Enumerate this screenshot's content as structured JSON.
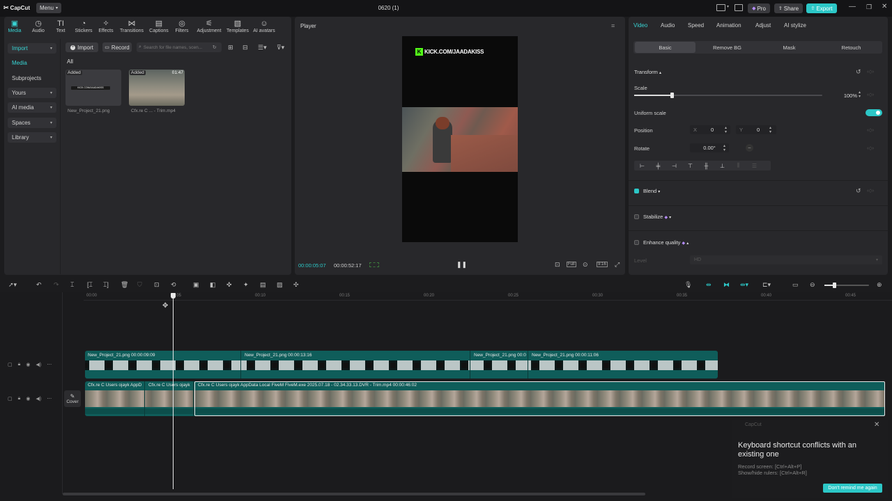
{
  "app": {
    "logo": "CapCut",
    "menu_label": "Menu",
    "project_title": "0620 (1)",
    "pro_label": "Pro",
    "share_label": "Share",
    "export_label": "Export",
    "accent": "#2cc7c7"
  },
  "toolbar": {
    "items": [
      {
        "label": "Media",
        "icon": "media-icon"
      },
      {
        "label": "Audio",
        "icon": "audio-icon"
      },
      {
        "label": "Text",
        "icon": "text-icon"
      },
      {
        "label": "Stickers",
        "icon": "stickers-icon"
      },
      {
        "label": "Effects",
        "icon": "effects-icon"
      },
      {
        "label": "Transitions",
        "icon": "transitions-icon"
      },
      {
        "label": "Captions",
        "icon": "captions-icon"
      },
      {
        "label": "Filters",
        "icon": "filters-icon"
      },
      {
        "label": "Adjustment",
        "icon": "adjustment-icon"
      },
      {
        "label": "Templates",
        "icon": "templates-icon"
      },
      {
        "label": "AI avatars",
        "icon": "ai-avatars-icon"
      }
    ]
  },
  "sidebar": {
    "items": [
      {
        "label": "Import"
      },
      {
        "label": "Media"
      },
      {
        "label": "Subprojects"
      },
      {
        "label": "Yours"
      },
      {
        "label": "AI media"
      },
      {
        "label": "Spaces"
      },
      {
        "label": "Library"
      }
    ]
  },
  "media": {
    "import_label": "Import",
    "record_label": "Record",
    "search_placeholder": "Search for file names, scen...",
    "filter_label": "All",
    "items": [
      {
        "name": "New_Project_21.png",
        "badge": "Added",
        "duration": ""
      },
      {
        "name": "Cfx.re  C ... - Trim.mp4",
        "badge": "Added",
        "duration": "01:47"
      }
    ],
    "thumb_text": "KICK.COM/JAADAKISS"
  },
  "player": {
    "title": "Player",
    "overlay_text": "KICK.COM/JAADAKISS",
    "current_time": "00:00:05:07",
    "total_time": "00:00:52:17",
    "full_label": "Full",
    "ratio_label": "9:16"
  },
  "props": {
    "tabs": [
      "Video",
      "Audio",
      "Speed",
      "Animation",
      "Adjust",
      "AI stylize"
    ],
    "sub_tabs": [
      "Basic",
      "Remove BG",
      "Mask",
      "Retouch"
    ],
    "transform_label": "Transform",
    "scale_label": "Scale",
    "scale_value": "100%",
    "scale_fraction": 0.2,
    "uniform_label": "Uniform scale",
    "position_label": "Position",
    "x_label": "X",
    "x_value": "0",
    "y_label": "Y",
    "y_value": "0",
    "rotate_label": "Rotate",
    "rotate_value": "0.00°",
    "blend_label": "Blend",
    "stabilize_label": "Stabilize",
    "enhance_label": "Enhance quality",
    "level_label": "Level",
    "level_value": "HD"
  },
  "timeline": {
    "ruler": [
      "00:00",
      "00:05",
      "00:10",
      "00:15",
      "00:20",
      "00:25",
      "00:30",
      "00:35",
      "00:40",
      "00:45"
    ],
    "overlay_clips": [
      {
        "name": "New_Project_21.png",
        "duration": "00:00:09:09"
      },
      {
        "name": "New_Project_21.png",
        "duration": "00:00:13:16"
      },
      {
        "name": "New_Project_21.png",
        "duration": "00:0"
      },
      {
        "name": "New_Project_21.png",
        "duration": "00:00:11:06"
      }
    ],
    "main_clips": [
      {
        "name": "Cfx.re  C  Users ojayk AppD",
        "duration": ""
      },
      {
        "name": "Cfx.re  C  Users ojayk",
        "duration": ""
      },
      {
        "name": "Cfx.re  C  Users ojayk AppData Local FiveM FiveM.exe 2025.07.18 - 02.34.33.13.DVR - Trim.mp4",
        "duration": "00:00:46:02"
      }
    ],
    "cover_label": "Cover"
  },
  "toast": {
    "brand": "CapCut",
    "title": "Keyboard shortcut conflicts with an existing one",
    "line1": "Record screen: [Ctrl+Alt+P]",
    "line2": "Show/hide rulers: [Ctrl+Alt+R]",
    "button": "Don't remind me again"
  }
}
